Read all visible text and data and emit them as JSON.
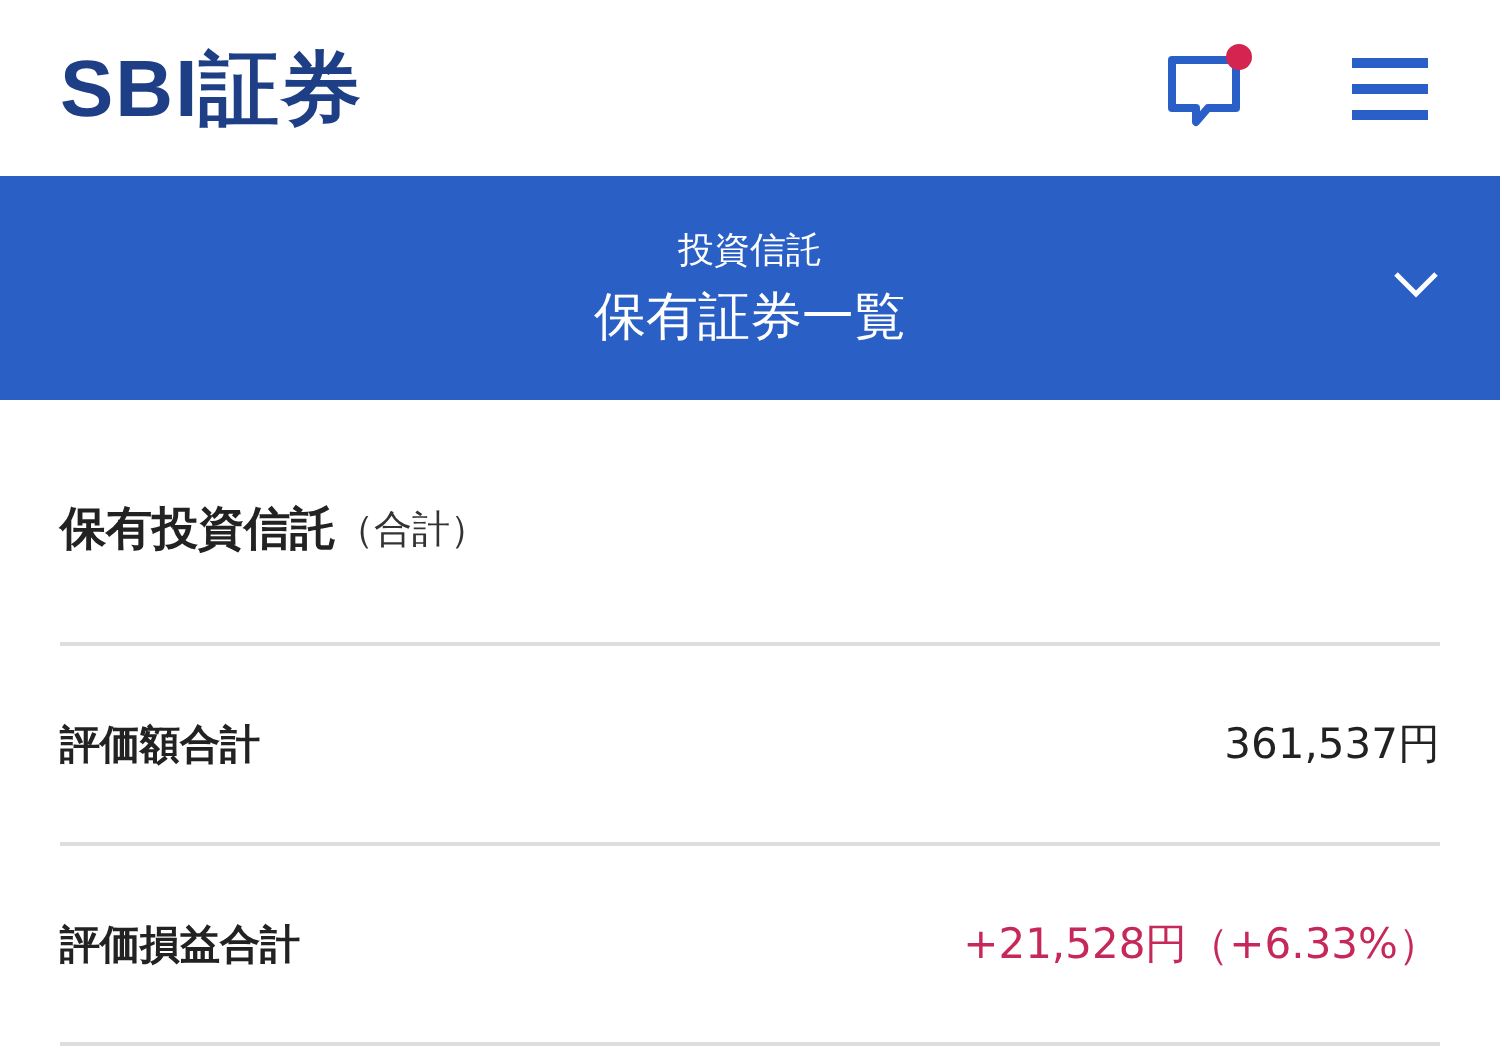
{
  "header": {
    "logo": "SBI証券",
    "has_notification": true
  },
  "title_bar": {
    "category": "投資信託",
    "title": "保有証券一覧",
    "expanded": false
  },
  "section": {
    "title": "保有投資信託",
    "suffix": "（合計）"
  },
  "rows": [
    {
      "label": "評価額合計",
      "value": "361,537円",
      "color": "#222222"
    },
    {
      "label": "評価損益合計",
      "value": "+21,528円（+6.33%）",
      "color": "#c6285a"
    }
  ]
}
